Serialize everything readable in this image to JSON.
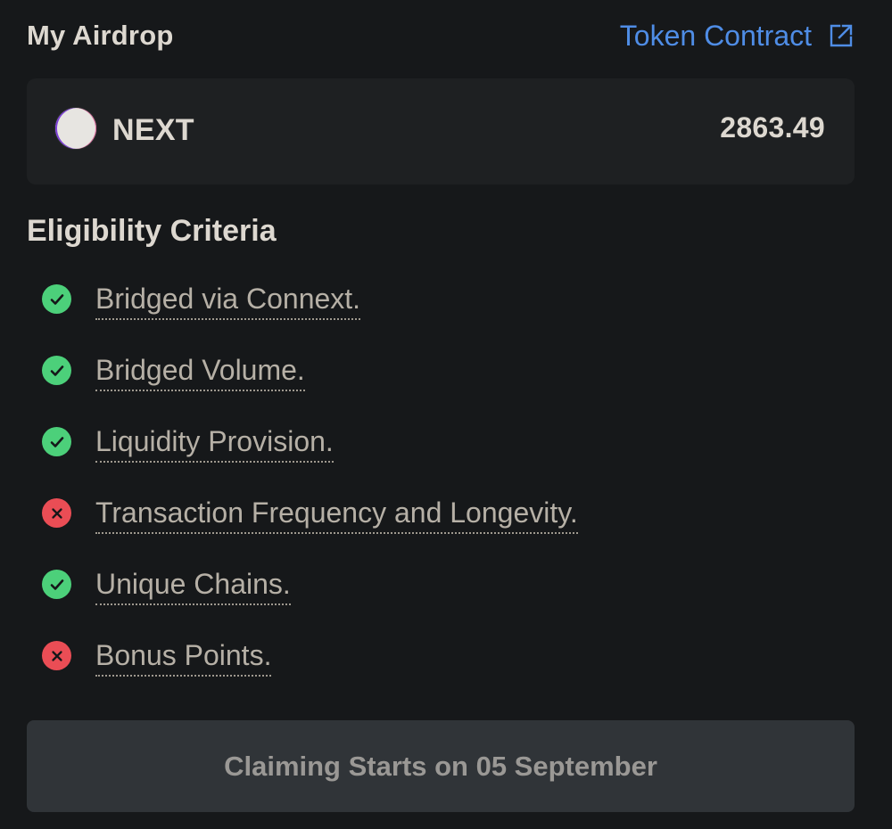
{
  "header": {
    "title": "My Airdrop",
    "token_contract_label": "Token Contract",
    "external_icon": "external-link-icon"
  },
  "token": {
    "symbol": "NEXT",
    "amount": "2863.49",
    "logo_icon": "token-logo-circle"
  },
  "eligibility": {
    "title": "Eligibility Criteria",
    "items": [
      {
        "label": "Bridged via Connext.",
        "status": "pass"
      },
      {
        "label": "Bridged Volume.",
        "status": "pass"
      },
      {
        "label": "Liquidity Provision.",
        "status": "pass"
      },
      {
        "label": "Transaction Frequency and Longevity.",
        "status": "fail"
      },
      {
        "label": "Unique Chains.",
        "status": "pass"
      },
      {
        "label": "Bonus Points.",
        "status": "fail"
      }
    ]
  },
  "claim": {
    "label": "Claiming Starts on 05 September",
    "disabled": true
  },
  "colors": {
    "background": "#16181a",
    "card": "#1e2022",
    "text": "#ddd8d0",
    "muted_text": "#b6b0a6",
    "link": "#4f8de6",
    "pass": "#4cd07a",
    "fail": "#ea4d55",
    "button": "#303438",
    "button_text": "#9a9895"
  }
}
